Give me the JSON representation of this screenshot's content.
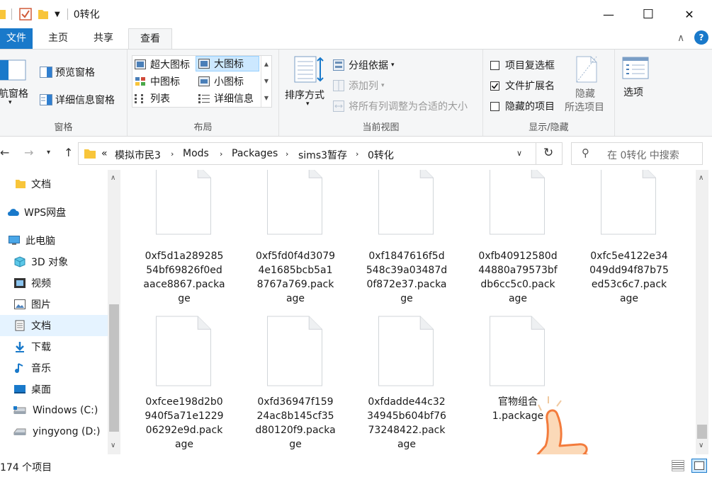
{
  "window": {
    "title": "0转化",
    "minimize_glyph": "—",
    "maximize_glyph": "☐",
    "close_glyph": "✕"
  },
  "tabs": {
    "file": "文件",
    "home": "主页",
    "share": "共享",
    "view": "查看"
  },
  "ribbon": {
    "panes": {
      "label": "窗格",
      "nav_pane": "导航窗格",
      "preview_pane": "预览窗格",
      "details_pane": "详细信息窗格"
    },
    "layout": {
      "label": "布局",
      "extra_large": "超大图标",
      "large": "大图标",
      "medium": "中图标",
      "small": "小图标",
      "list": "列表",
      "details": "详细信息"
    },
    "current_view": {
      "label": "当前视图",
      "sort_by": "排序方式",
      "group_by": "分组依据",
      "add_columns": "添加列",
      "size_all_columns": "将所有列调整为合适的大小"
    },
    "show_hide": {
      "label": "显示/隐藏",
      "item_checkboxes": "项目复选框",
      "file_extensions": "文件扩展名",
      "hidden_items": "隐藏的项目",
      "hide_selected_1": "隐藏",
      "hide_selected_2": "所选项目",
      "item_checkboxes_checked": false,
      "file_extensions_checked": true,
      "hidden_items_checked": false
    },
    "options": "选项"
  },
  "address": {
    "overflow": "«",
    "crumbs": [
      "模拟市民3",
      "Mods",
      "Packages",
      "sims3暂存",
      "0转化"
    ],
    "search_placeholder": "在 0转化 中搜索"
  },
  "nav": {
    "items": [
      {
        "label": "文档",
        "icon": "folder-icon"
      },
      {
        "label": "WPS网盘",
        "icon": "cloud-icon"
      },
      {
        "label": "此电脑",
        "icon": "computer-icon"
      },
      {
        "label": "3D 对象",
        "icon": "cube-icon"
      },
      {
        "label": "视频",
        "icon": "video-icon"
      },
      {
        "label": "图片",
        "icon": "picture-icon"
      },
      {
        "label": "文档",
        "icon": "document-icon"
      },
      {
        "label": "下载",
        "icon": "download-icon"
      },
      {
        "label": "音乐",
        "icon": "music-icon"
      },
      {
        "label": "桌面",
        "icon": "desktop-icon"
      },
      {
        "label": "Windows (C:)",
        "icon": "drive-icon"
      },
      {
        "label": "yingyong (D:)",
        "icon": "drive-icon"
      }
    ]
  },
  "files": {
    "row1": [
      {
        "lines": [
          "0xf5d1a289285",
          "54bf69826f0ed",
          "aace8867.packa",
          "ge"
        ]
      },
      {
        "lines": [
          "0xf5fd0f4d3079",
          "4e1685bcb5a1",
          "8767a769.pack",
          "age"
        ]
      },
      {
        "lines": [
          "0xf1847616f5d",
          "548c39a03487d",
          "0f872e37.packa",
          "ge"
        ]
      },
      {
        "lines": [
          "0xfb40912580d",
          "44880a79573bf",
          "db6cc5c0.pack",
          "age"
        ]
      },
      {
        "lines": [
          "0xfc5e4122e34",
          "049dd94f87b75",
          "ed53c6c7.pack",
          "age"
        ]
      }
    ],
    "row2": [
      {
        "lines": [
          "0xfcee198d2b0",
          "940f5a71e1229",
          "06292e9d.pack",
          "age"
        ]
      },
      {
        "lines": [
          "0xfd36947f159",
          "24ac8b145cf35",
          "d80120f9.packa",
          "ge"
        ]
      },
      {
        "lines": [
          "0xfdadde44c32",
          "34945b604bf76",
          "73248422.pack",
          "age"
        ]
      },
      {
        "lines": [
          "官物组合",
          "1.package"
        ]
      }
    ]
  },
  "status": {
    "item_count": "174 个项目"
  },
  "colors": {
    "accent": "#1979ca",
    "selected_bg": "#cce8ff",
    "thumb_skin": "#fbd9b8",
    "thumb_outline": "#f37b3c"
  }
}
